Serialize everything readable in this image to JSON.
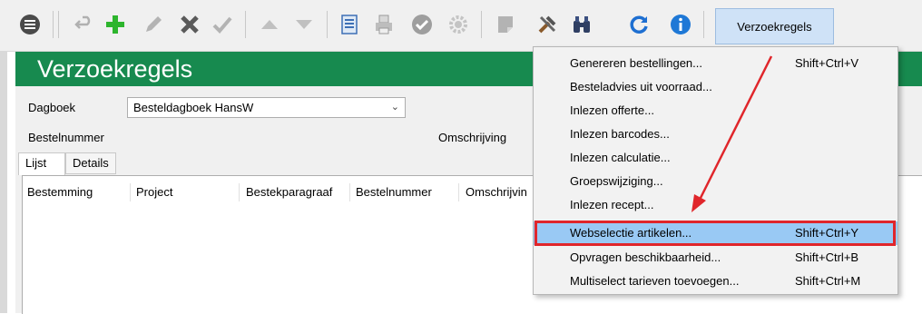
{
  "toolbar": {
    "icons": [
      "menu-icon",
      "undo-icon",
      "add-icon",
      "edit-icon",
      "delete-icon",
      "confirm-icon",
      "move-up-icon",
      "move-down-icon",
      "print-preview-icon",
      "print-icon",
      "check-circle-icon",
      "settings-gear-icon",
      "note-icon",
      "tools-icon",
      "binoculars-icon",
      "refresh-icon",
      "info-icon"
    ],
    "menu_button_label": "Verzoekregels"
  },
  "window": {
    "title": "Verzoekregels",
    "title_color": "#178a4f"
  },
  "form": {
    "dagboek_label": "Dagboek",
    "dagboek_value": "Besteldagboek HansW",
    "bestelnummer_label": "Bestelnummer",
    "omschrijving_label": "Omschrijving"
  },
  "tabs": [
    {
      "label": "Lijst",
      "active": true
    },
    {
      "label": "Details",
      "active": false
    }
  ],
  "list": {
    "columns": [
      "Bestemming",
      "Project",
      "Bestekparagraaf",
      "Bestelnummer",
      "Omschrijvin"
    ]
  },
  "menu": {
    "items": [
      {
        "label": "Genereren bestellingen...",
        "shortcut": "Shift+Ctrl+V"
      },
      {
        "label": "Besteladvies uit voorraad...",
        "shortcut": ""
      },
      {
        "label": "Inlezen offerte...",
        "shortcut": ""
      },
      {
        "label": "Inlezen barcodes...",
        "shortcut": ""
      },
      {
        "label": "Inlezen calculatie...",
        "shortcut": ""
      },
      {
        "label": "Groepswijziging...",
        "shortcut": ""
      },
      {
        "label": "Inlezen recept...",
        "shortcut": ""
      },
      {
        "label": "Webselectie artikelen...",
        "shortcut": "Shift+Ctrl+Y",
        "highlighted": true
      },
      {
        "label": "Opvragen beschikbaarheid...",
        "shortcut": "Shift+Ctrl+B"
      },
      {
        "label": "Multiselect tarieven toevoegen...",
        "shortcut": "Shift+Ctrl+M"
      }
    ],
    "highlight_color": "#99c9f4",
    "annotation_color": "#e0262b"
  }
}
